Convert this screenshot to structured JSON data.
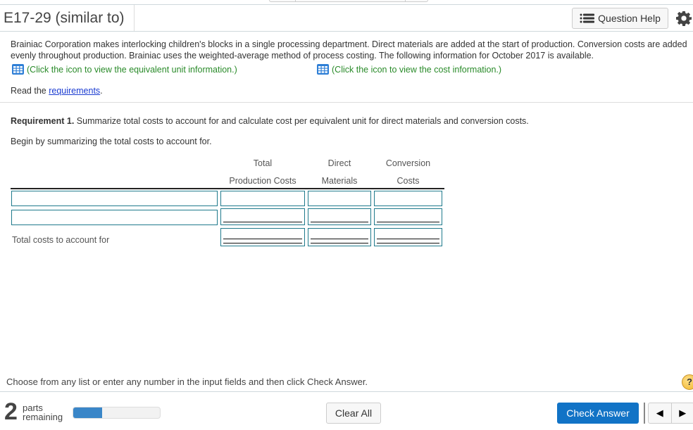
{
  "header": {
    "title": "E17-29 (similar to)",
    "question_help_label": "Question Help"
  },
  "problem": {
    "description": "Brainiac Corporation makes interlocking children's blocks in a single processing department. Direct materials are added at the start of production. Conversion costs are added evenly throughout production. Brainiac uses the weighted-average method of process costing. The following information for October 2017 is available.",
    "equivalent_unit_link": "(Click the icon to view the equivalent unit information.)",
    "cost_info_link": "(Click the icon to view the cost information.)",
    "read_prefix": "Read the ",
    "requirements_link": "requirements",
    "read_suffix": "."
  },
  "requirement": {
    "label": "Requirement 1.",
    "text": " Summarize total costs to account for and calculate cost per equivalent unit for direct materials and conversion costs.",
    "begin_text": "Begin by summarizing the total costs to account for."
  },
  "table": {
    "columns": [
      {
        "line1": "Total",
        "line2": "Production Costs"
      },
      {
        "line1": "Direct",
        "line2": "Materials"
      },
      {
        "line1": "Conversion",
        "line2": "Costs"
      }
    ],
    "rows": [
      {
        "label_value": "",
        "values": [
          "",
          "",
          ""
        ]
      },
      {
        "label_value": "",
        "values": [
          "",
          "",
          ""
        ]
      },
      {
        "label": "Total costs to account for",
        "values": [
          "",
          "",
          ""
        ]
      }
    ]
  },
  "footer": {
    "instruction": "Choose from any list or enter any number in the input fields and then click Check Answer.",
    "help_icon": "?",
    "parts_remaining_count": "2",
    "parts_label_1": "parts",
    "parts_label_2": "remaining",
    "progress_percent": 33,
    "clear_all_label": "Clear All",
    "check_answer_label": "Check Answer",
    "prev_icon": "◀",
    "next_icon": "▶"
  },
  "colors": {
    "link_green": "#2a8b2a",
    "input_border": "#1f7a8c",
    "primary_button": "#1173c6",
    "progress_fill": "#3a86c8"
  }
}
